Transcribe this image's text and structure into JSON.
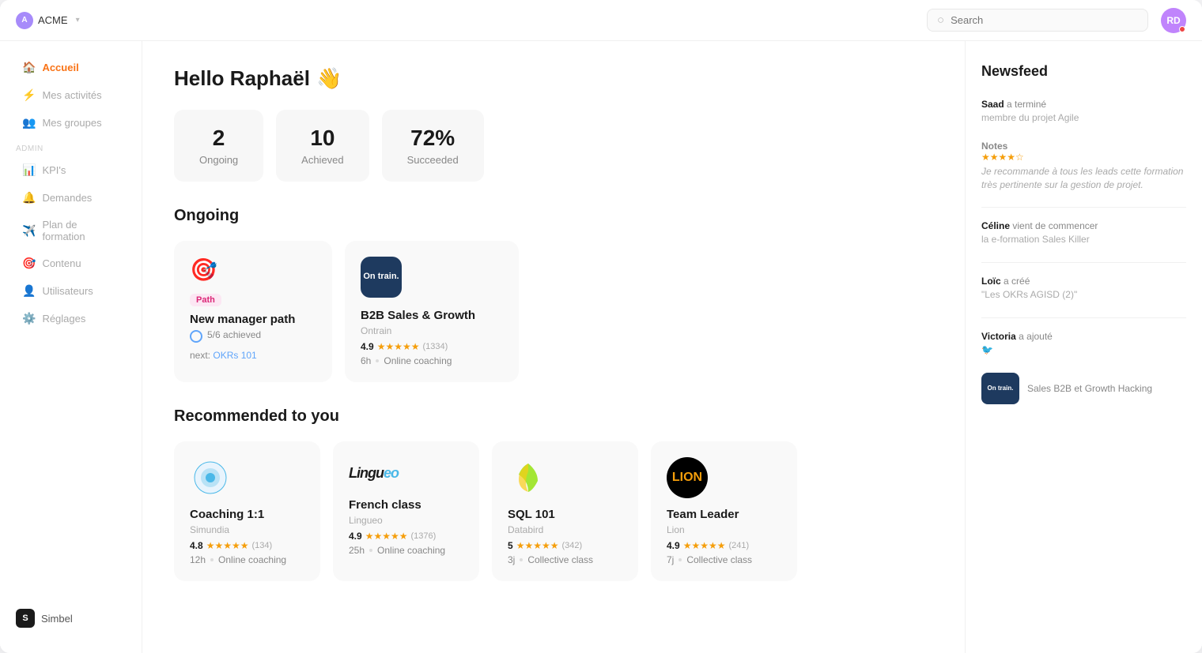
{
  "topbar": {
    "app_name": "ACME",
    "app_icon": "A",
    "search_placeholder": "Search",
    "avatar_initials": "RD"
  },
  "sidebar": {
    "items": [
      {
        "id": "accueil",
        "label": "Accueil",
        "icon": "🏠",
        "active": true
      },
      {
        "id": "mes-activites",
        "label": "Mes activités",
        "icon": "⚡",
        "active": false
      },
      {
        "id": "mes-groupes",
        "label": "Mes groupes",
        "icon": "👥",
        "active": false
      },
      {
        "id": "kpis",
        "label": "KPI's",
        "icon": "📊",
        "active": false
      },
      {
        "id": "demandes",
        "label": "Demandes",
        "icon": "🔔",
        "active": false
      },
      {
        "id": "plan-formation",
        "label": "Plan de formation",
        "icon": "✈️",
        "active": false
      },
      {
        "id": "contenu",
        "label": "Contenu",
        "icon": "🎯",
        "active": false
      },
      {
        "id": "utilisateurs",
        "label": "Utilisateurs",
        "icon": "👤",
        "active": false
      },
      {
        "id": "reglages",
        "label": "Réglages",
        "icon": "⚙️",
        "active": false
      }
    ],
    "section_label": "Admin",
    "brand_name": "Simbel",
    "brand_icon": "S"
  },
  "main": {
    "greeting": "Hello Raphaël",
    "greeting_emoji": "👋",
    "stats": [
      {
        "number": "2",
        "label": "Ongoing"
      },
      {
        "number": "10",
        "label": "Achieved"
      },
      {
        "number": "72%",
        "label": "Succeeded"
      }
    ],
    "ongoing_title": "Ongoing",
    "ongoing_courses": [
      {
        "id": "new-manager",
        "badge": "Path",
        "icon_type": "goal",
        "title": "New manager path",
        "progress": "5/6 achieved",
        "next_label": "next:",
        "next_link_text": "OKRs 101"
      },
      {
        "id": "b2b-sales",
        "icon_type": "ontrain",
        "title": "B2B Sales & Growth",
        "provider": "Ontrain",
        "rating": "4.9",
        "stars": 5,
        "review_count": "(1334)",
        "duration": "6h",
        "format": "Online coaching"
      }
    ],
    "recommended_title": "Recommended to you",
    "recommended_courses": [
      {
        "id": "coaching",
        "icon_type": "simundia",
        "title": "Coaching 1:1",
        "provider": "Simundia",
        "rating": "4.8",
        "stars": 5,
        "review_count": "(134)",
        "duration": "12h",
        "format": "Online coaching"
      },
      {
        "id": "french",
        "icon_type": "lingueo",
        "title": "French class",
        "provider": "Lingueo",
        "rating": "4.9",
        "stars": 5,
        "review_count": "(1376)",
        "duration": "25h",
        "format": "Online coaching"
      },
      {
        "id": "sql",
        "icon_type": "databird",
        "title": "SQL 101",
        "provider": "Databird",
        "rating": "5",
        "stars": 5,
        "review_count": "(342)",
        "duration": "3j",
        "format": "Collective class"
      },
      {
        "id": "teamleader",
        "icon_type": "lion",
        "title": "Team Leader",
        "provider": "Lion",
        "rating": "4.9",
        "stars": 5,
        "review_count": "(241)",
        "duration": "7j",
        "format": "Collective class"
      }
    ]
  },
  "newsfeed": {
    "title": "Newsfeed",
    "items": [
      {
        "user": "Saad",
        "action": "a terminé",
        "detail": "membre du projet Agile",
        "type": "completion"
      },
      {
        "section": "Notes",
        "stars": 4,
        "comment": "Je recommande à tous les leads cette formation très pertinente sur la gestion de projet.",
        "type": "review"
      },
      {
        "user": "Céline",
        "action": "vient de commencer",
        "detail": "la e-formation Sales Killer",
        "type": "started"
      },
      {
        "user": "Loïc",
        "action": "a créé",
        "detail": "\"Les OKRs AGISD (2)\"",
        "type": "created"
      },
      {
        "user": "Victoria",
        "action": "a ajouté",
        "detail": "🐦",
        "type": "added"
      },
      {
        "thumbnail": true,
        "thumb_label": "On train.",
        "title": "Sales B2B et Growth Hacking",
        "user": "Victoria",
        "action": "a ajouté",
        "type": "thumbnail"
      }
    ]
  }
}
